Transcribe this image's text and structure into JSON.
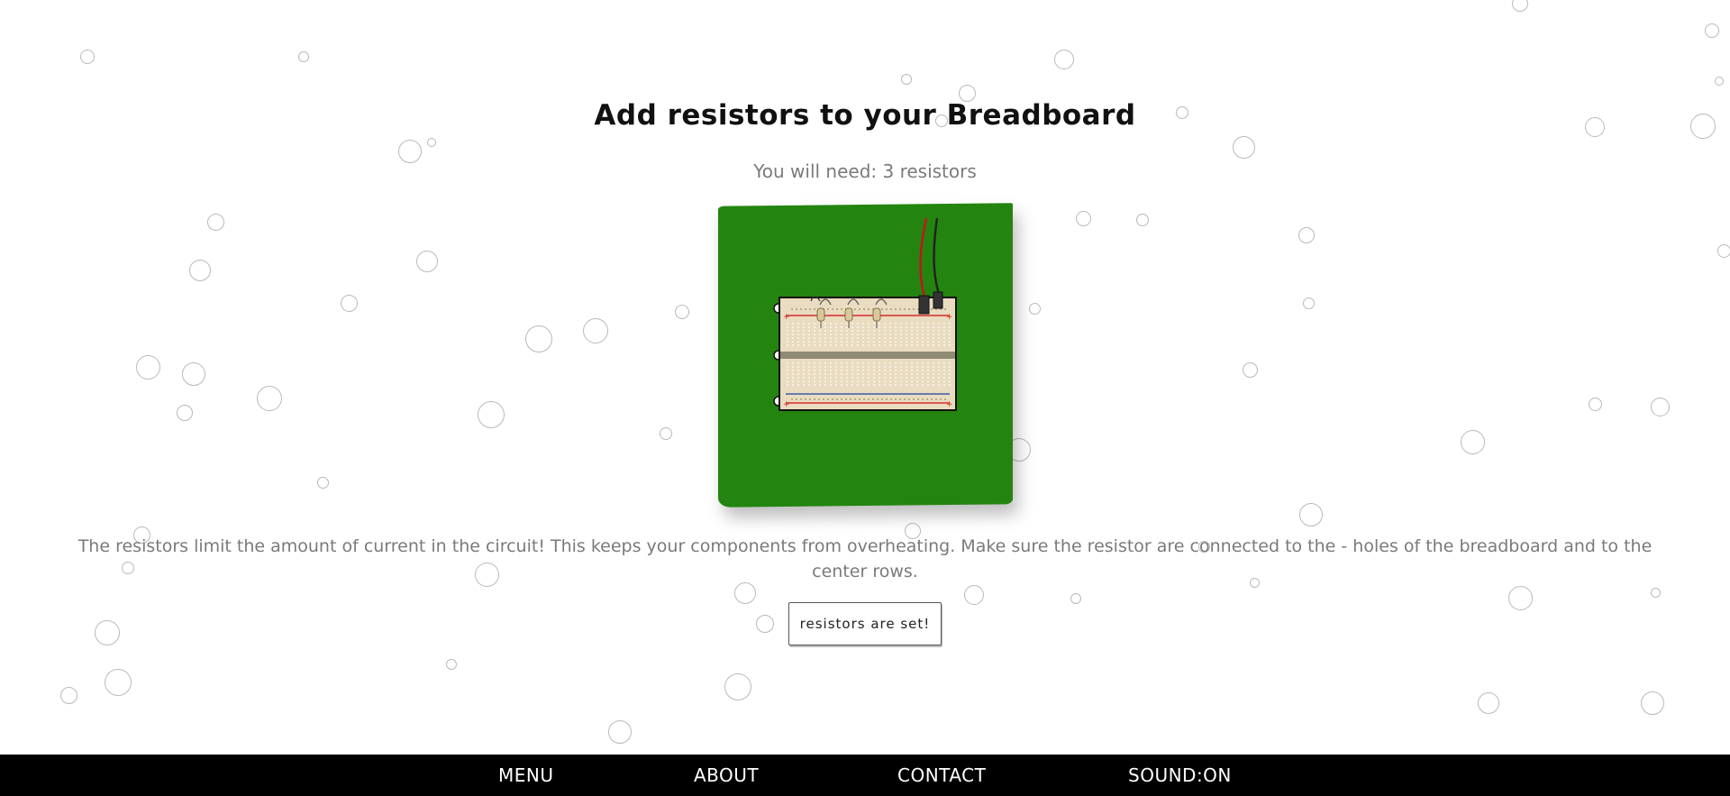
{
  "page": {
    "title": "Add resistors to your Breadboard",
    "subtitle": "You will need: 3 resistors",
    "description": "The resistors limit the amount of current in the circuit! This keeps your components from overheating. Make sure the resistor are connected to the - holes of the breadboard and to the center rows.",
    "confirm_label": "resistors are set!"
  },
  "breadboard": {
    "resistor_count": 3,
    "colors": {
      "card": "#238510",
      "board": "#e9dcc0",
      "positive_rail": "#d62d2d",
      "negative_rail": "#3a5ca8",
      "wire_red": "#c0161a",
      "wire_black": "#222222"
    }
  },
  "nav": {
    "menu": "MENU",
    "about": "ABOUT",
    "contact": "CONTACT",
    "sound": "SOUND:ON"
  }
}
